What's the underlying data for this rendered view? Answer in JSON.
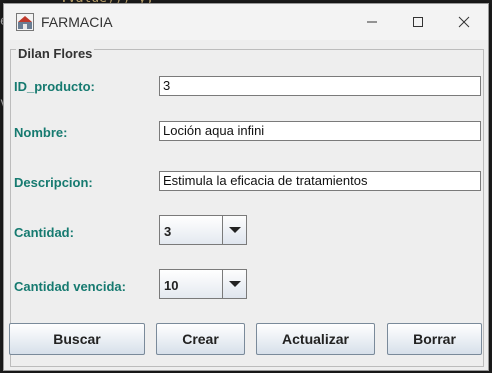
{
  "window": {
    "title": "FARMACIA"
  },
  "panel": {
    "title": "Dilan Flores"
  },
  "fields": {
    "id_producto": {
      "label": "ID_producto:",
      "value": "3"
    },
    "nombre": {
      "label": "Nombre:",
      "value": "Loción aqua infini"
    },
    "descripcion": {
      "label": "Descripcion:",
      "value": "Estimula la eficacia de tratamientos"
    },
    "cantidad": {
      "label": "Cantidad:",
      "value": "3"
    },
    "cantidad_vencida": {
      "label": "Cantidad vencida:",
      "value": "10"
    }
  },
  "buttons": {
    "buscar": "Buscar",
    "crear": "Crear",
    "actualizar": "Actualizar",
    "borrar": "Borrar"
  },
  "colors": {
    "label": "#167a70",
    "window_bg": "#eeeeee"
  }
}
